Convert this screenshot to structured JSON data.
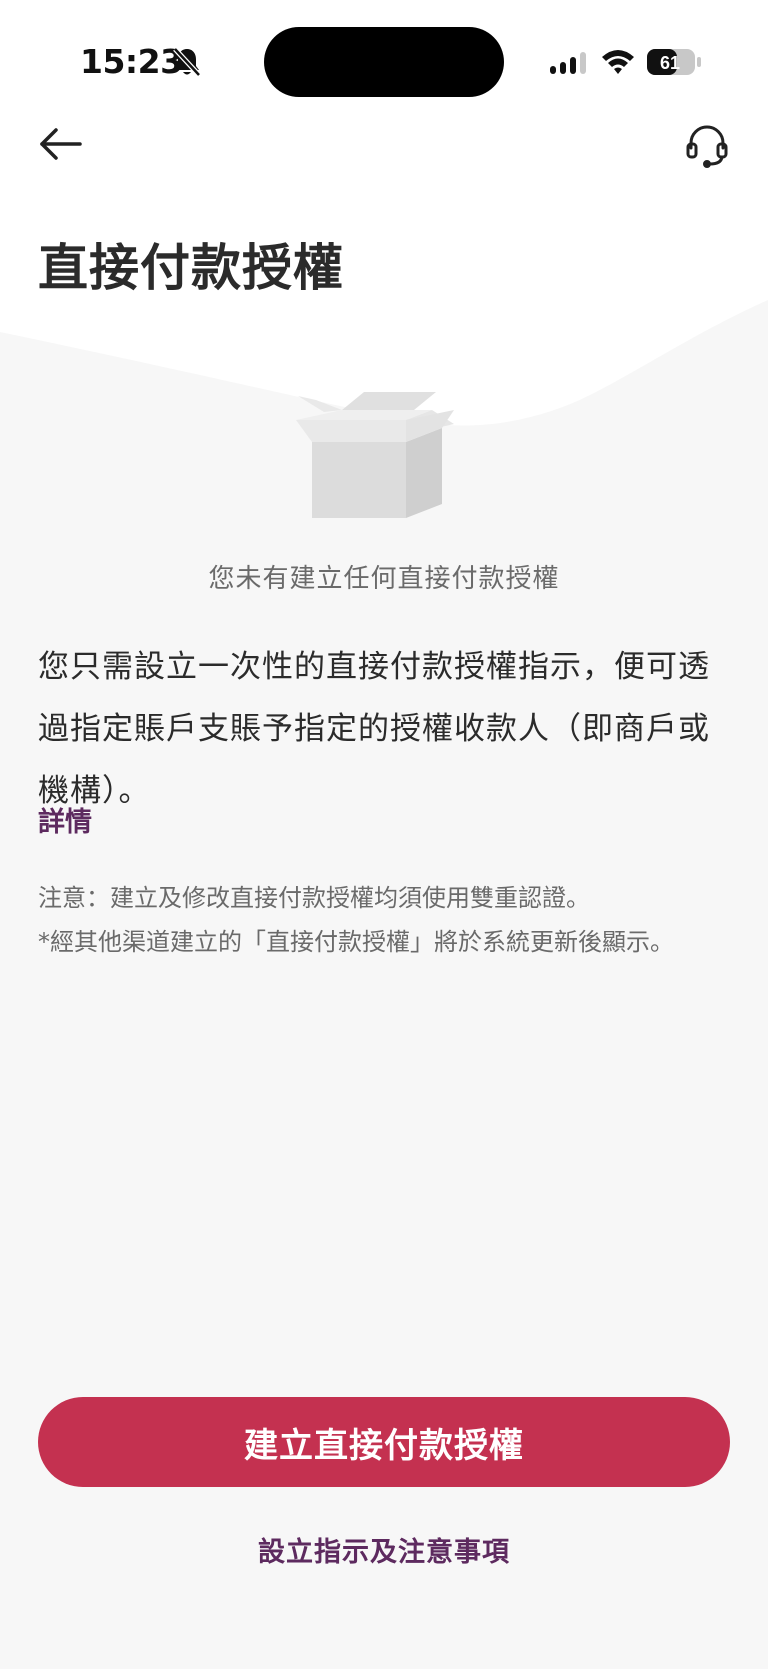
{
  "status_bar": {
    "time": "15:23",
    "battery_level": "61",
    "icons": [
      "bell-off-icon",
      "cellular-signal-icon",
      "wifi-icon",
      "battery-icon"
    ]
  },
  "header": {
    "back_icon": "arrow-left-icon",
    "support_icon": "headset-icon",
    "title": "直接付款授權"
  },
  "empty_state": {
    "illustration_icon": "empty-box-icon",
    "message": "您未有建立任何直接付款授權"
  },
  "description": {
    "text": "您只需設立一次性的直接付款授權指示，便可透過指定賬戶支賬予指定的授權收款人（即商戶或機構）。",
    "details_link": "詳情"
  },
  "notes": {
    "line1": "注意：建立及修改直接付款授權均須使用雙重認證。",
    "line2": "*經其他渠道建立的「直接付款授權」將於系統更新後顯示。"
  },
  "actions": {
    "create_button": "建立直接付款授權",
    "instructions_link": "設立指示及注意事項"
  },
  "colors": {
    "primary": "#c43150",
    "link": "#5d2a5f",
    "background": "#f7f7f7",
    "text": "#2b2b2b"
  }
}
